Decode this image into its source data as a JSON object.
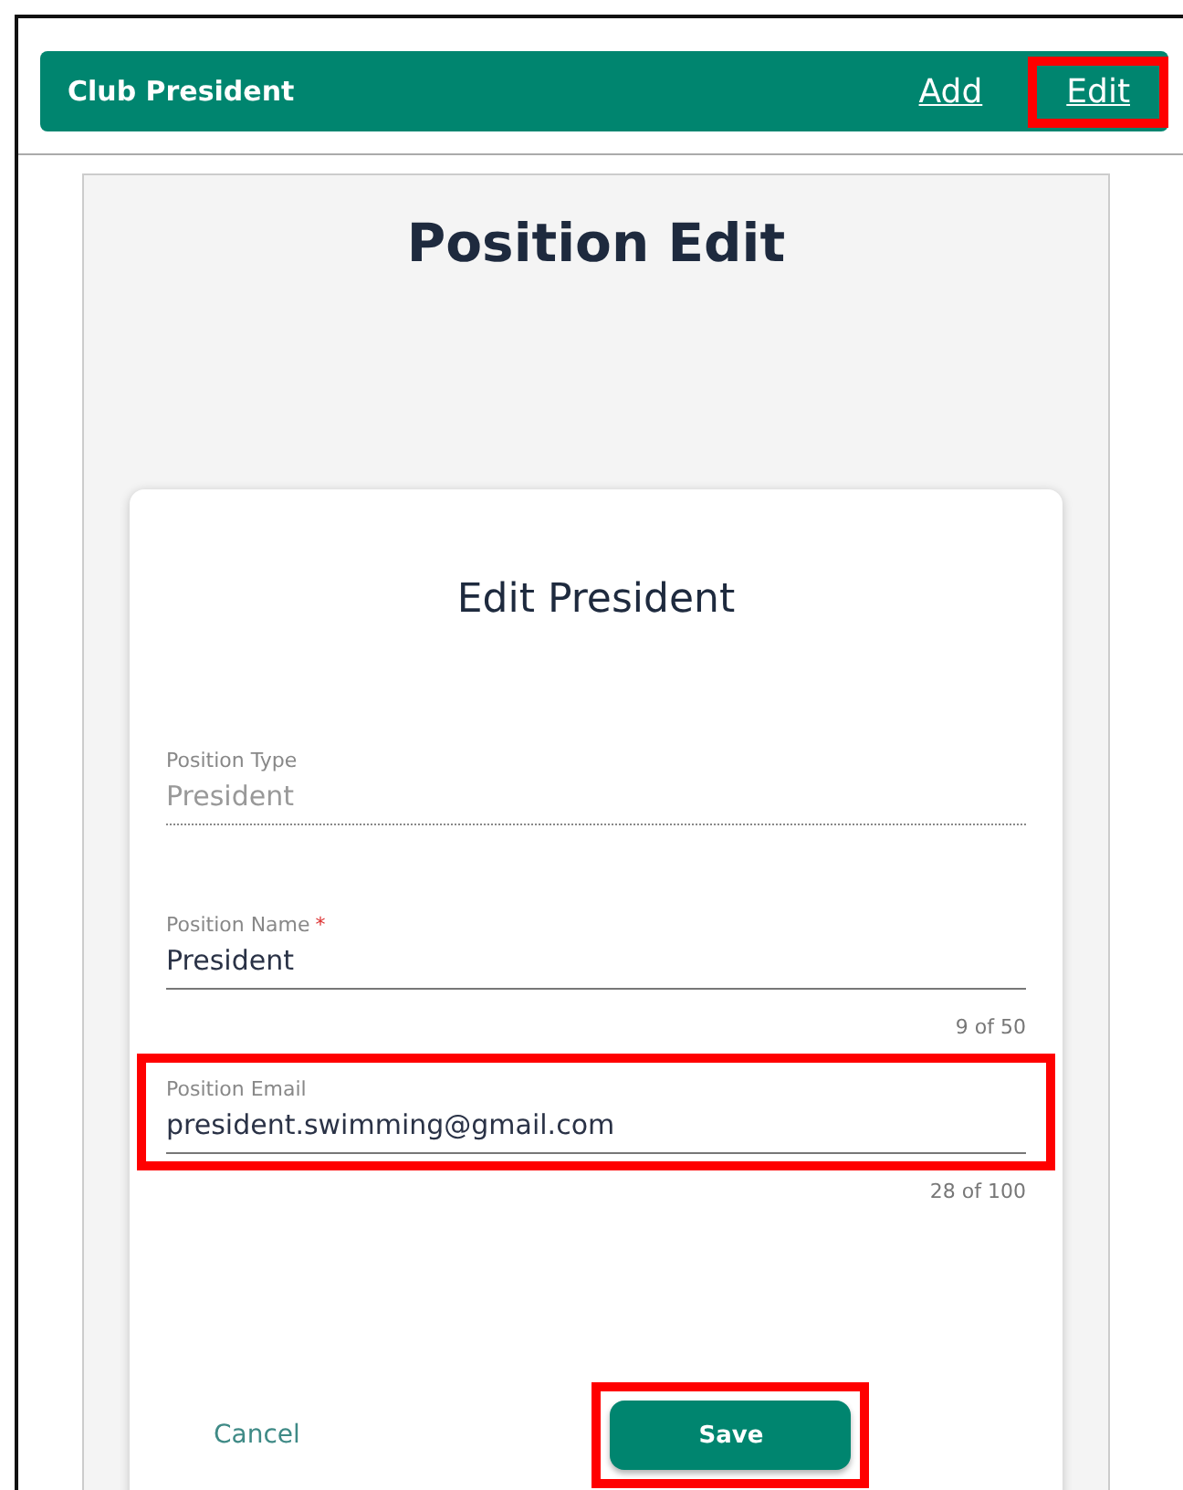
{
  "header": {
    "title": "Club President",
    "links": [
      {
        "label": "Add",
        "highlighted": false
      },
      {
        "label": "Edit",
        "highlighted": true
      }
    ]
  },
  "page_title": "Position Edit",
  "card": {
    "title": "Edit President",
    "fields": [
      {
        "kind": "readonly",
        "label": "Position Type",
        "value": "President",
        "highlighted": false
      },
      {
        "kind": "text",
        "label": "Position Name",
        "value": "President",
        "required_mark": "*",
        "counter": "9 of 50",
        "highlighted": false
      },
      {
        "kind": "text",
        "label": "Position Email",
        "value": "president.swimming@gmail.com",
        "counter": "28 of 100",
        "highlighted": true
      }
    ],
    "cancel": {
      "label": "Cancel"
    },
    "save": {
      "label": "Save",
      "highlighted": true
    }
  }
}
